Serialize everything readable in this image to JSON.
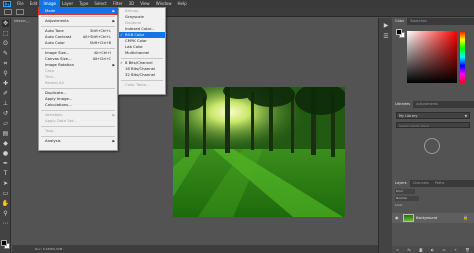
{
  "app": {
    "logo": "Ps"
  },
  "menubar": [
    {
      "label": "File"
    },
    {
      "label": "Edit"
    },
    {
      "label": "Image"
    },
    {
      "label": "Layer"
    },
    {
      "label": "Type"
    },
    {
      "label": "Select"
    },
    {
      "label": "Filter"
    },
    {
      "label": "3D"
    },
    {
      "label": "View"
    },
    {
      "label": "Window"
    },
    {
      "label": "Help"
    }
  ],
  "document": {
    "tab": "MF9301_...",
    "status": "Doc: 5.03M/5.03M"
  },
  "image_menu": [
    {
      "label": "Mode",
      "arrow": "▶",
      "state": "highlighted"
    },
    {
      "type": "sep"
    },
    {
      "label": "Adjustments",
      "arrow": "▶"
    },
    {
      "type": "sep"
    },
    {
      "label": "Auto Tone",
      "shortcut": "Shift+Ctrl+L"
    },
    {
      "label": "Auto Contrast",
      "shortcut": "Alt+Shift+Ctrl+L"
    },
    {
      "label": "Auto Color",
      "shortcut": "Shift+Ctrl+B"
    },
    {
      "type": "sep"
    },
    {
      "label": "Image Size...",
      "shortcut": "Alt+Ctrl+I"
    },
    {
      "label": "Canvas Size...",
      "shortcut": "Alt+Ctrl+C"
    },
    {
      "label": "Image Rotation",
      "arrow": "▶"
    },
    {
      "label": "Crop",
      "state": "disabled"
    },
    {
      "label": "Trim...",
      "state": "disabled"
    },
    {
      "label": "Reveal All",
      "state": "disabled"
    },
    {
      "type": "sep"
    },
    {
      "label": "Duplicate..."
    },
    {
      "label": "Apply Image..."
    },
    {
      "label": "Calculations..."
    },
    {
      "type": "sep"
    },
    {
      "label": "Variables",
      "arrow": "▶",
      "state": "disabled"
    },
    {
      "label": "Apply Data Set...",
      "state": "disabled"
    },
    {
      "type": "sep"
    },
    {
      "label": "Trap...",
      "state": "disabled"
    },
    {
      "type": "sep"
    },
    {
      "label": "Analysis",
      "arrow": "▶"
    }
  ],
  "mode_submenu": [
    {
      "label": "Bitmap",
      "state": "disabled"
    },
    {
      "label": "Grayscale"
    },
    {
      "label": "Duotone",
      "state": "disabled"
    },
    {
      "label": "Indexed Color..."
    },
    {
      "label": "RGB Color",
      "checked": true,
      "state": "highlighted"
    },
    {
      "label": "CMYK Color"
    },
    {
      "label": "Lab Color"
    },
    {
      "label": "Multichannel"
    },
    {
      "type": "sep"
    },
    {
      "label": "8 Bits/Channel",
      "checked": true
    },
    {
      "label": "16 Bits/Channel"
    },
    {
      "label": "32 Bits/Channel"
    },
    {
      "type": "sep"
    },
    {
      "label": "Color Table...",
      "state": "disabled"
    }
  ],
  "panels": {
    "color_tabs": [
      {
        "label": "Color",
        "active": true
      },
      {
        "label": "Swatches"
      }
    ],
    "library_tabs": [
      {
        "label": "Libraries",
        "active": true
      },
      {
        "label": "Adjustments"
      }
    ],
    "library_select": "My Library",
    "library_search": "Search Adobe Stock",
    "layers_tabs": [
      {
        "label": "Layers",
        "active": true
      },
      {
        "label": "Channels"
      },
      {
        "label": "Paths"
      }
    ],
    "layers_kind": "Kind",
    "layers_mode": "Normal",
    "layers_lock": "Lock:",
    "layer_name": "Background"
  },
  "colors": {
    "accent": "#1473e6",
    "highlight_outline": "#e8301e"
  }
}
